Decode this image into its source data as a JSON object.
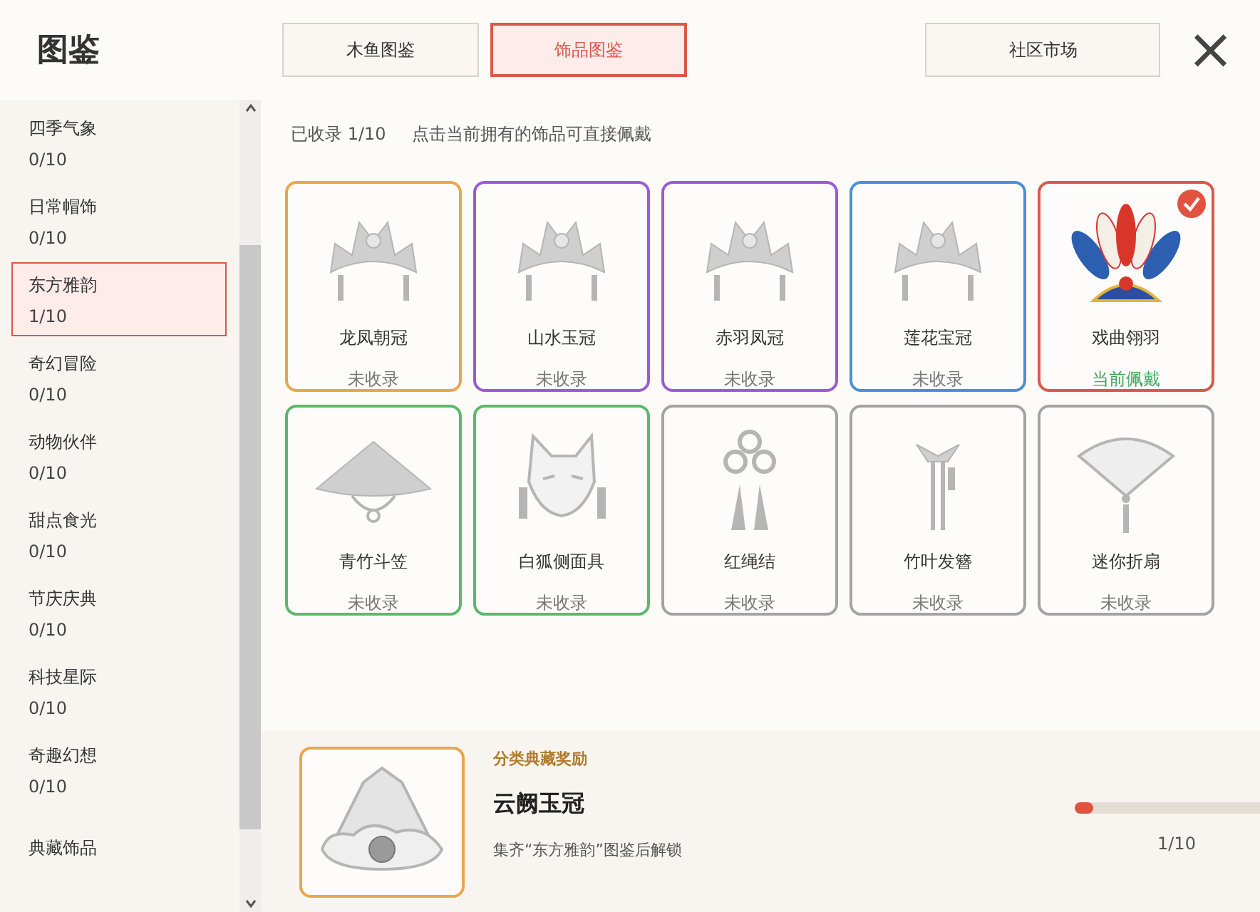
{
  "header": {
    "title": "图鉴",
    "close": "×"
  },
  "tabs": [
    {
      "label": "木鱼图鉴",
      "selected": false
    },
    {
      "label": "饰品图鉴",
      "selected": true
    }
  ],
  "market_button": "社区市场",
  "sidebar": {
    "items": [
      {
        "name": "四季气象",
        "count": "0/10",
        "selected": false
      },
      {
        "name": "日常帽饰",
        "count": "0/10",
        "selected": false
      },
      {
        "name": "东方雅韵",
        "count": "1/10",
        "selected": true
      },
      {
        "name": "奇幻冒险",
        "count": "0/10",
        "selected": false
      },
      {
        "name": "动物伙伴",
        "count": "0/10",
        "selected": false
      },
      {
        "name": "甜点食光",
        "count": "0/10",
        "selected": false
      },
      {
        "name": "节庆庆典",
        "count": "0/10",
        "selected": false
      },
      {
        "name": "科技星际",
        "count": "0/10",
        "selected": false
      },
      {
        "name": "奇趣幻想",
        "count": "0/10",
        "selected": false
      },
      {
        "name": "典藏饰品",
        "selected": false
      }
    ]
  },
  "summary": {
    "collected": "已收录 1/10",
    "hint": "点击当前拥有的饰品可直接佩戴"
  },
  "items": [
    {
      "name": "龙凤朝冠",
      "status": "未收录",
      "kind": "crown",
      "color": "#eaa64c",
      "selected": false
    },
    {
      "name": "山水玉冠",
      "status": "未收录",
      "kind": "crown",
      "color": "#9a5bd6",
      "selected": false
    },
    {
      "name": "赤羽凤冠",
      "status": "未收录",
      "kind": "crown",
      "color": "#9a5bd6",
      "selected": false
    },
    {
      "name": "莲花宝冠",
      "status": "未收录",
      "kind": "crown",
      "color": "#4a8fd8",
      "selected": false
    },
    {
      "name": "戏曲翎羽",
      "status": "当前佩戴",
      "kind": "feathers",
      "color": "#d9584a",
      "selected": true
    },
    {
      "name": "青竹斗笠",
      "status": "未收录",
      "kind": "hat",
      "color": "#5cb86a",
      "selected": false
    },
    {
      "name": "白狐侧面具",
      "status": "未收录",
      "kind": "mask",
      "color": "#5cb86a",
      "selected": false
    },
    {
      "name": "红绳结",
      "status": "未收录",
      "kind": "knot",
      "color": "#a3a3a3",
      "selected": false
    },
    {
      "name": "竹叶发簪",
      "status": "未收录",
      "kind": "hairpin",
      "color": "#a3a3a3",
      "selected": false
    },
    {
      "name": "迷你折扇",
      "status": "未收录",
      "kind": "fan",
      "color": "#a3a3a3",
      "selected": false
    }
  ],
  "reward": {
    "label": "分类典藏奖励",
    "name": "云阙玉冠",
    "condition": "集齐“东方雅韵”图鉴后解锁",
    "progress": "1/10",
    "level": 0.1
  }
}
